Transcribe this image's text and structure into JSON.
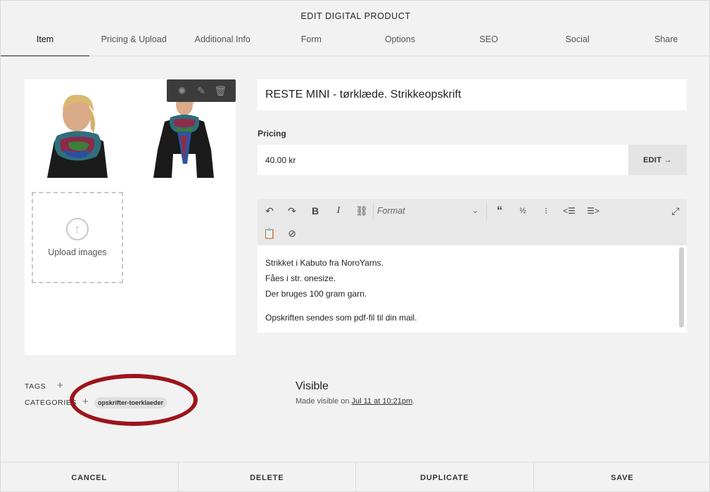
{
  "header": {
    "title": "EDIT DIGITAL PRODUCT"
  },
  "tabs": [
    {
      "label": "Item",
      "active": true
    },
    {
      "label": "Pricing & Upload"
    },
    {
      "label": "Additional Info"
    },
    {
      "label": "Form"
    },
    {
      "label": "Options"
    },
    {
      "label": "SEO"
    },
    {
      "label": "Social"
    },
    {
      "label": "Share"
    }
  ],
  "images": {
    "toolbar_icons": [
      "settings-icon",
      "pencil-icon",
      "trash-icon"
    ],
    "upload_label": "Upload images"
  },
  "product": {
    "title": "RESTE MINI - tørklæde. Strikkeopskrift",
    "pricing_label": "Pricing",
    "price": "40.00 kr",
    "edit_label": "EDIT →"
  },
  "editor": {
    "format_label": "Format",
    "lines": [
      "Strikket i Kabuto fra NoroYarns.",
      "Fåes i str. onesize.",
      "Der bruges 100 gram garn.",
      "Opskriften sendes som pdf-fil til din mail."
    ]
  },
  "meta": {
    "tags_label": "TAGS",
    "categories_label": "CATEGORIES",
    "category_chip": "opskrifter-toerklaeder",
    "highlight_color": "#9c151b"
  },
  "visibility": {
    "title": "Visible",
    "prefix": "Made visible on ",
    "date_link": "Jul 11 at 10:21pm",
    "suffix": "."
  },
  "footer": {
    "cancel": "CANCEL",
    "delete": "DELETE",
    "duplicate": "DUPLICATE",
    "save": "SAVE"
  }
}
